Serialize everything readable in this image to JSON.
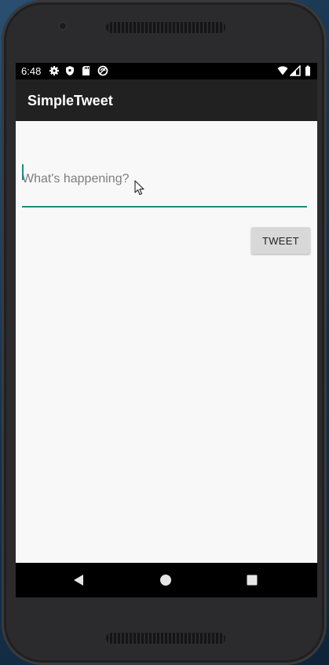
{
  "status_bar": {
    "time": "6:48",
    "left_icons": [
      "settings-icon",
      "shield-icon",
      "sd-card-icon",
      "sync-icon"
    ],
    "right_icons": [
      "wifi-icon",
      "signal-icon",
      "battery-icon"
    ]
  },
  "app_bar": {
    "title": "SimpleTweet"
  },
  "compose": {
    "input_value": "",
    "input_placeholder": "What's happening?",
    "tweet_button_label": "TWEET"
  },
  "nav_bar": {
    "buttons": [
      "back-icon",
      "home-icon",
      "recents-icon"
    ]
  },
  "colors": {
    "app_bar": "#212121",
    "content_bg": "#f8f8f8",
    "accent_underline": "#1e8a7a",
    "button_bg": "#d8d8d8"
  }
}
